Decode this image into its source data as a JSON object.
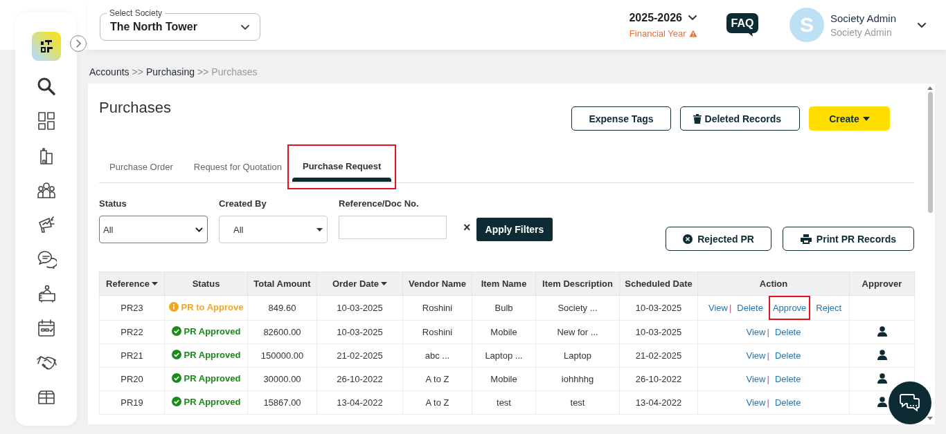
{
  "sidebar": {
    "expanded": false
  },
  "society_select": {
    "label": "Select Society",
    "value": "The North Tower"
  },
  "financial_year": {
    "value": "2025-2026",
    "label": "Financial Year"
  },
  "faq": "FAQ",
  "user": {
    "initial": "S",
    "name": "Society Admin",
    "role": "Society Admin"
  },
  "breadcrumb": [
    {
      "kind": "link",
      "label": "Accounts"
    },
    {
      "kind": "separator",
      "label": ">>"
    },
    {
      "kind": "link",
      "label": "Purchasing"
    },
    {
      "kind": "separator",
      "label": ">>"
    },
    {
      "kind": "current",
      "label": "Purchases"
    }
  ],
  "page_title": "Purchases",
  "buttons": [
    {
      "kind": "outline",
      "label": "Expense Tags"
    },
    {
      "kind": "outline_trash",
      "label": "Deleted Records"
    },
    {
      "kind": "primary_dropdown",
      "label": "Create"
    }
  ],
  "tabs": [
    {
      "label": "Purchase Order",
      "selected": false,
      "highlighted": false
    },
    {
      "label": "Request for Quotation",
      "selected": false,
      "highlighted": false
    },
    {
      "label": "Purchase Request",
      "selected": true,
      "highlighted": true
    }
  ],
  "filters": [
    {
      "kind": "select",
      "label": "Status",
      "value": "All"
    },
    {
      "kind": "dropdown",
      "label": "Created By",
      "value": "All"
    },
    {
      "kind": "text",
      "label": "Reference/Doc No."
    }
  ],
  "clear_filters": "×",
  "apply_filters": "Apply Filters",
  "side_buttons": [
    {
      "kind": "rejected",
      "label": "Rejected PR"
    },
    {
      "kind": "print",
      "label": "Print PR Records"
    }
  ],
  "table": {
    "columns": [
      {
        "label": "Reference",
        "sortable": true
      },
      {
        "label": "Status",
        "sortable": false
      },
      {
        "label": "Total Amount",
        "sortable": false
      },
      {
        "label": "Order Date",
        "sortable": true
      },
      {
        "label": "Vendor Name",
        "sortable": false
      },
      {
        "label": "Item Name",
        "sortable": false
      },
      {
        "label": "Item Description",
        "sortable": false
      },
      {
        "label": "Scheduled Date",
        "sortable": false
      },
      {
        "label": "Action",
        "sortable": false
      },
      {
        "label": "Approver",
        "sortable": false
      }
    ],
    "rows": [
      {
        "reference": "PR23",
        "status": "PR to Approve",
        "approved": false,
        "total_amount": "849.60",
        "order_date": "10-03-2025",
        "vendor_name": "Roshini",
        "item_name": "Bulb",
        "item_description": "Society ...",
        "scheduled_date": "10-03-2025",
        "actions": [
          {
            "kind": "link",
            "label": "View",
            "highlighted": false
          },
          {
            "kind": "separator",
            "label": "|"
          },
          {
            "kind": "link",
            "label": "Delete",
            "highlighted": false
          },
          {
            "kind": "link",
            "label": "Approve",
            "highlighted": true
          },
          {
            "kind": "link",
            "label": "Reject",
            "highlighted": false
          }
        ],
        "approver_assigned": false
      },
      {
        "reference": "PR22",
        "status": "PR Approved",
        "approved": true,
        "total_amount": "82600.00",
        "order_date": "10-03-2025",
        "vendor_name": "Roshini",
        "item_name": "Mobile",
        "item_description": "New for ...",
        "scheduled_date": "10-03-2025",
        "actions": [
          {
            "kind": "link",
            "label": "View",
            "highlighted": false
          },
          {
            "kind": "separator",
            "label": "|"
          },
          {
            "kind": "link",
            "label": "Delete",
            "highlighted": false
          }
        ],
        "approver_assigned": true
      },
      {
        "reference": "PR21",
        "status": "PR Approved",
        "approved": true,
        "total_amount": "150000.00",
        "order_date": "21-02-2025",
        "vendor_name": "abc ...",
        "item_name": "Laptop ...",
        "item_description": "Laptop",
        "scheduled_date": "21-02-2025",
        "actions": [
          {
            "kind": "link",
            "label": "View",
            "highlighted": false
          },
          {
            "kind": "separator",
            "label": "|"
          },
          {
            "kind": "link",
            "label": "Delete",
            "highlighted": false
          }
        ],
        "approver_assigned": true
      },
      {
        "reference": "PR20",
        "status": "PR Approved",
        "approved": true,
        "total_amount": "30000.00",
        "order_date": "26-10-2022",
        "vendor_name": "A to Z",
        "item_name": "Mobile",
        "item_description": "iohhhhg",
        "scheduled_date": "26-10-2022",
        "actions": [
          {
            "kind": "link",
            "label": "View",
            "highlighted": false
          },
          {
            "kind": "separator",
            "label": "|"
          },
          {
            "kind": "link",
            "label": "Delete",
            "highlighted": false
          }
        ],
        "approver_assigned": true
      },
      {
        "reference": "PR19",
        "status": "PR Approved",
        "approved": true,
        "total_amount": "15867.00",
        "order_date": "13-04-2022",
        "vendor_name": "A to Z",
        "item_name": "test",
        "item_description": "test",
        "scheduled_date": "13-04-2022",
        "actions": [
          {
            "kind": "link",
            "label": "View",
            "highlighted": false
          },
          {
            "kind": "separator",
            "label": "|"
          },
          {
            "kind": "link",
            "label": "Delete",
            "highlighted": false
          }
        ],
        "approver_assigned": true
      }
    ]
  }
}
